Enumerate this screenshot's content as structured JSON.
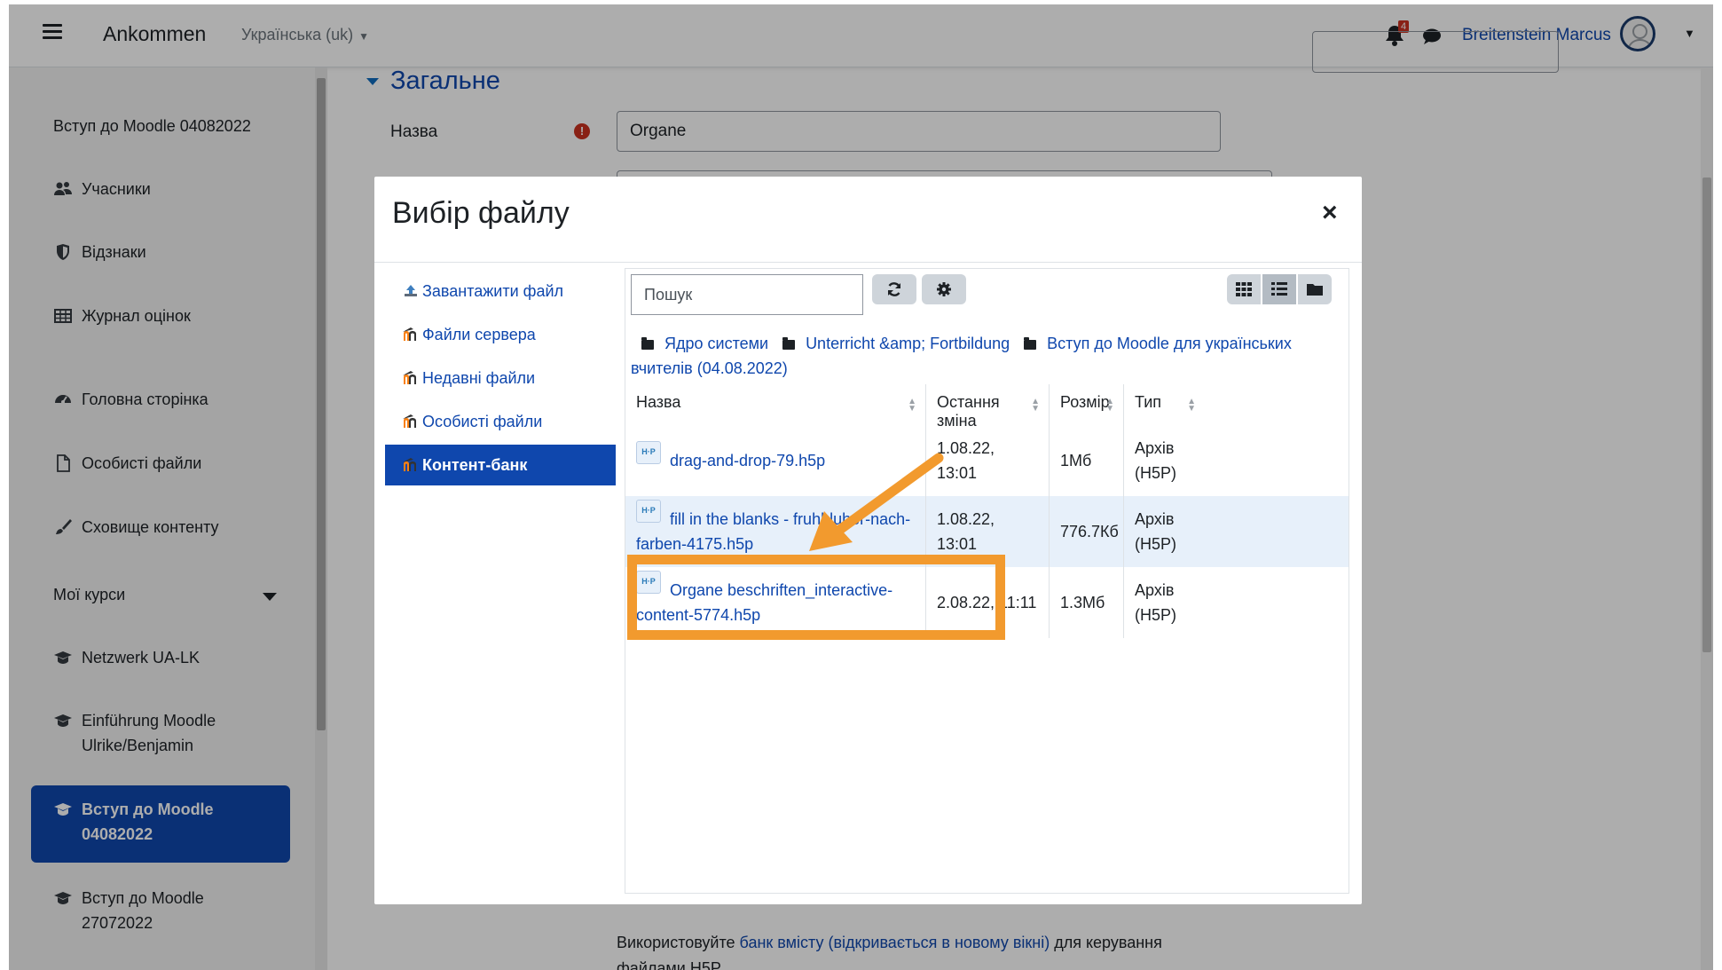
{
  "navbar": {
    "brand": "Ankommen",
    "language": "Українська (uk)",
    "notification_count": "4",
    "user_name": "Breitenstein Marcus"
  },
  "drawer": {
    "items": [
      {
        "label": "Вступ до Moodle 04082022",
        "icon": "none"
      },
      {
        "label": "Учасники",
        "icon": "users-icon"
      },
      {
        "label": "Відзнаки",
        "icon": "shield-icon"
      },
      {
        "label": "Журнал оцінок",
        "icon": "table-icon"
      },
      {
        "label": "Головна сторінка",
        "icon": "dashboard-icon"
      },
      {
        "label": "Особисті файли",
        "icon": "file-icon"
      },
      {
        "label": "Сховище контенту",
        "icon": "paint-brush-icon"
      },
      {
        "label": "Мої курси",
        "icon": "none"
      },
      {
        "label": "Netzwerk UA-LK",
        "icon": "graduation-cap-icon"
      },
      {
        "label": "Einführung Moodle Ulrike/Benjamin",
        "icon": "graduation-cap-icon"
      },
      {
        "label": "Вступ до Moodle 04082022",
        "icon": "graduation-cap-icon",
        "active": true
      },
      {
        "label": "Вступ до Moodle 27072022",
        "icon": "graduation-cap-icon"
      }
    ]
  },
  "main": {
    "section_title": "Загальне",
    "name_label": "Назва",
    "name_value": "Organe",
    "footer_prefix": "Використовуйте ",
    "footer_link": "банк вмісту (відкривається в новому вікні)",
    "footer_suffix": " для керування",
    "footer_line2": "файлами H5P"
  },
  "modal": {
    "title": "Вибір файлу",
    "close": "×",
    "repositories": [
      {
        "label": "Завантажити файл",
        "icon": "upload-icon"
      },
      {
        "label": "Файли сервера",
        "icon": "moodle-icon"
      },
      {
        "label": "Недавні файли",
        "icon": "moodle-icon"
      },
      {
        "label": "Особисті файли",
        "icon": "moodle-icon"
      },
      {
        "label": "Контент-банк",
        "icon": "moodle-icon",
        "active": true
      }
    ],
    "search_placeholder": "Пошук",
    "breadcrumb": [
      "Ядро системи",
      "Unterricht &amp; Fortbildung",
      "Вступ до Moodle для українських вчителів (04.08.2022)"
    ],
    "columns": [
      "Назва",
      "Остання зміна",
      "Розмір",
      "Тип"
    ],
    "files": [
      {
        "name": "drag-and-drop-79.h5p",
        "modified": "1.08.22, 13:01",
        "size": "1Мб",
        "type": "Архів (H5P)"
      },
      {
        "name": "fill in the blanks - fruhbluher-nach-farben-4175.h5p",
        "modified": "1.08.22, 13:01",
        "size": "776.7Кб",
        "type": "Архів (H5P)"
      },
      {
        "name": "Organe beschriften_interactive-content-5774.h5p",
        "modified": "2.08.22, 11:11",
        "size": "1.3Мб",
        "type": "Архів (H5P)"
      }
    ]
  },
  "colors": {
    "accent": "#0f47ad",
    "highlight": "#f29a2e",
    "active_nav": "#0f47ad"
  }
}
